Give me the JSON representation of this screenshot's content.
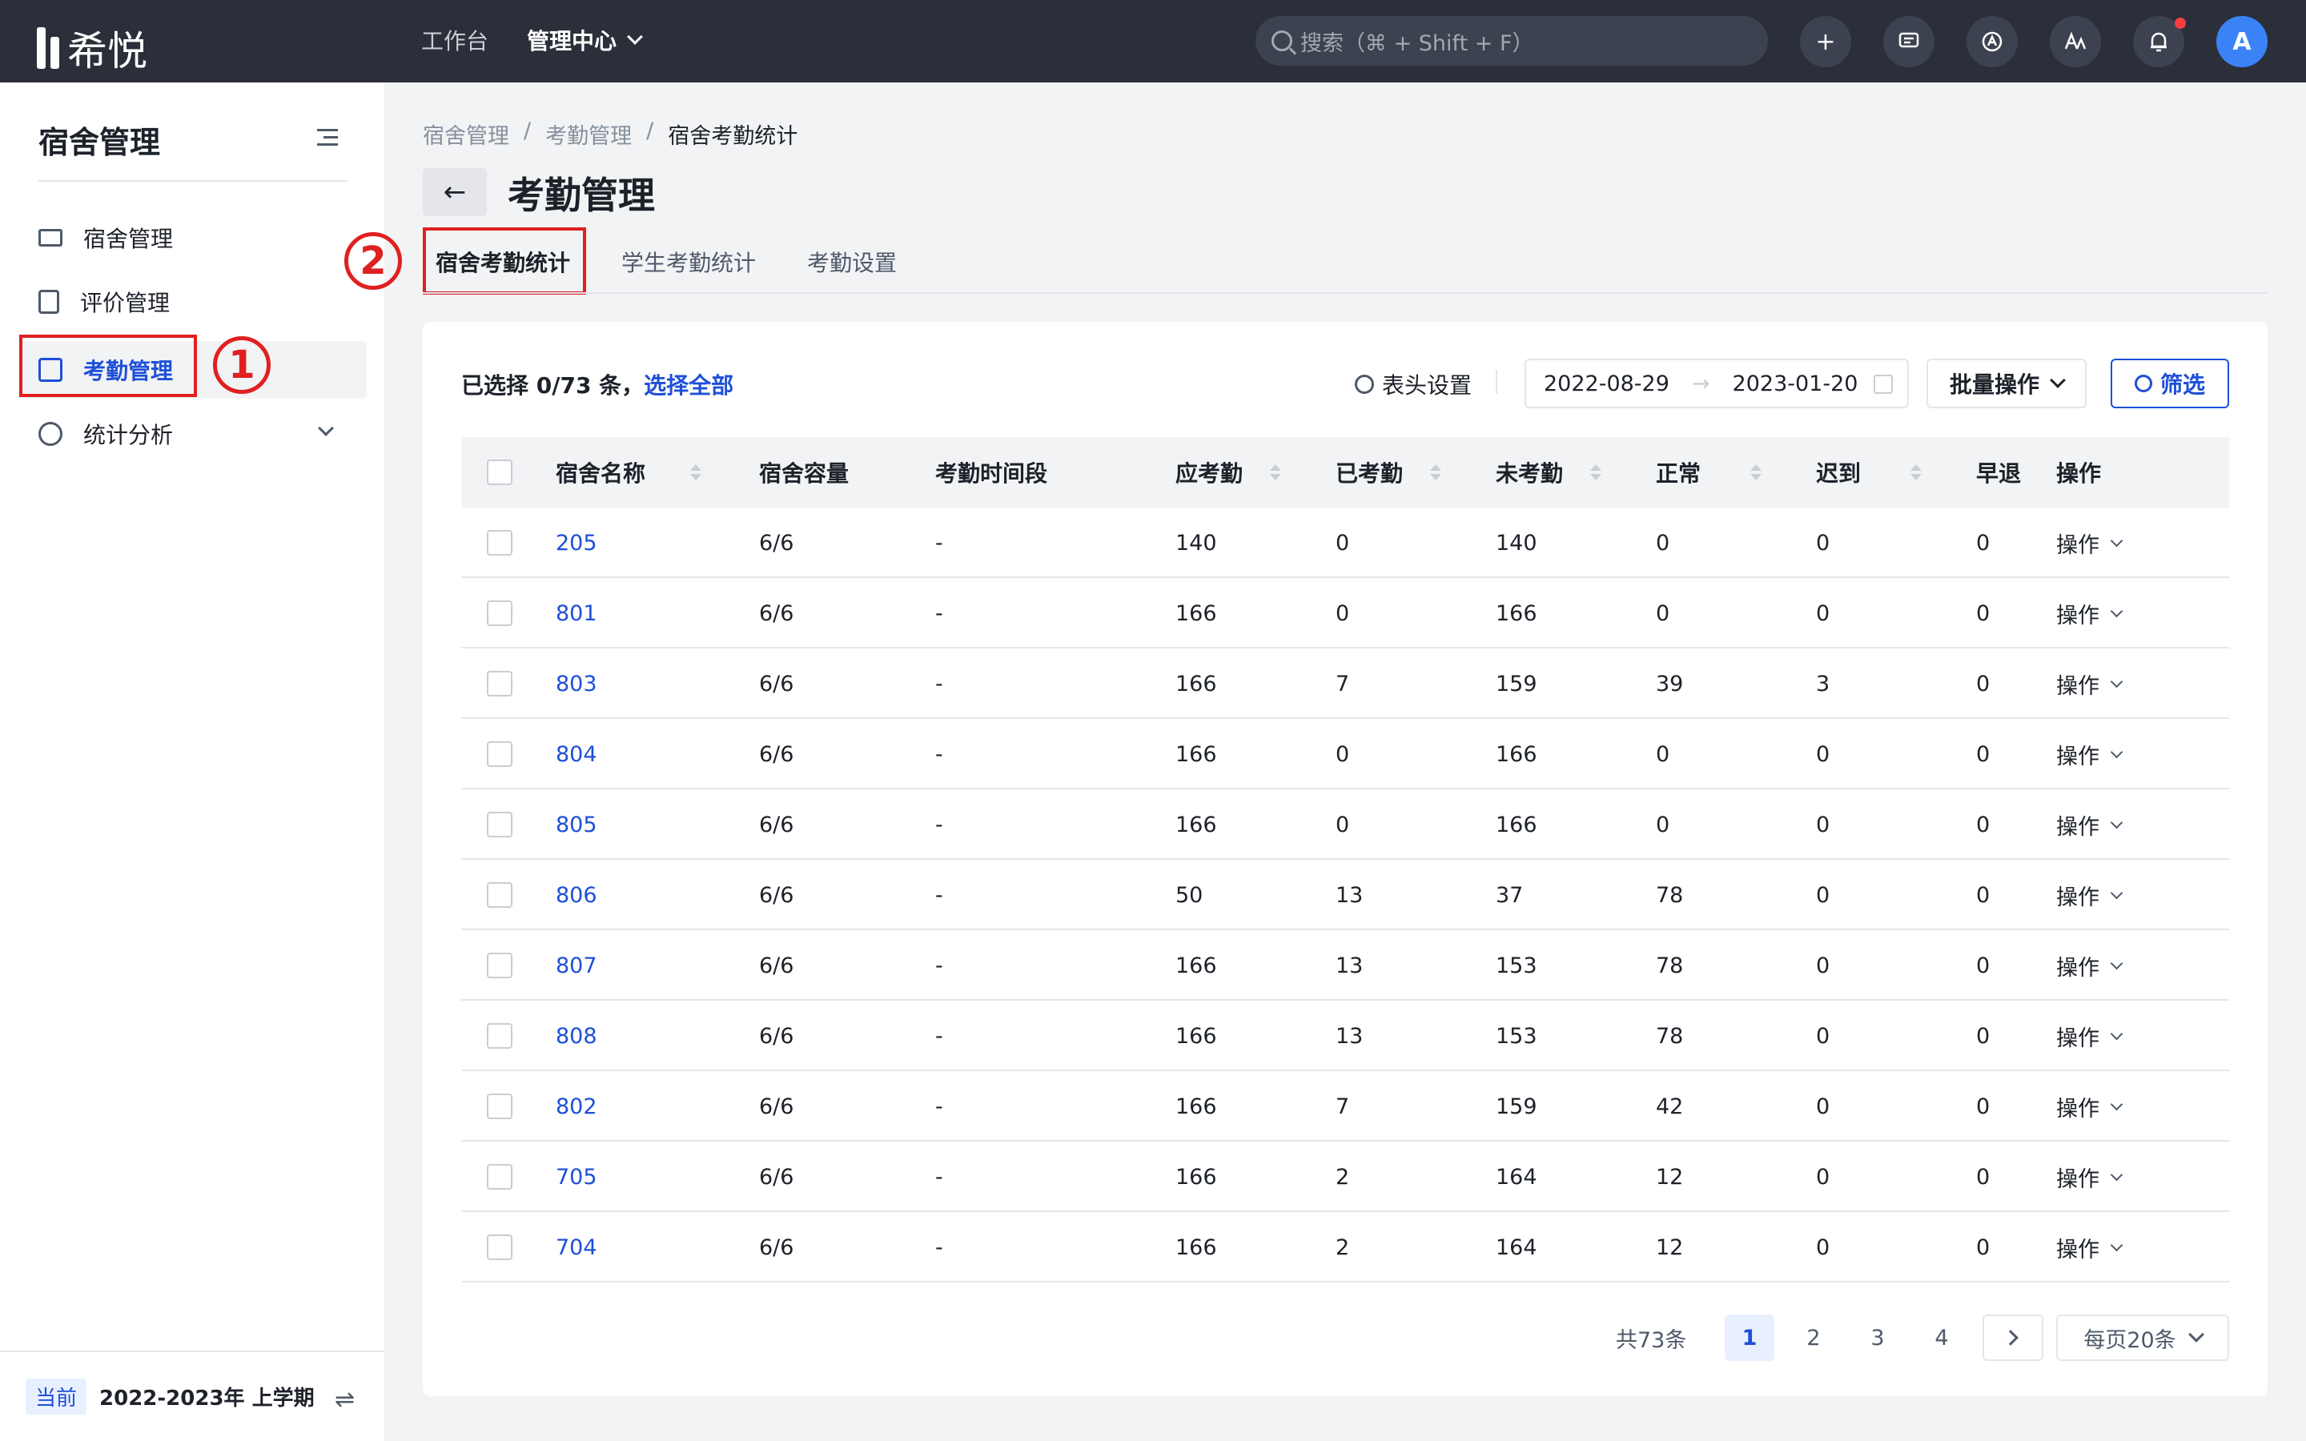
{
  "app": {
    "logo_text": "希悦"
  },
  "topnav": {
    "items": [
      "工作台",
      "管理中心"
    ],
    "search_placeholder": "搜索（⌘ + Shift + F）",
    "avatar": "A",
    "add": "+"
  },
  "sidebar": {
    "title": "宿舍管理",
    "items": [
      {
        "label": "宿舍管理",
        "icon": "bed-icon"
      },
      {
        "label": "评价管理",
        "icon": "document-chart-icon"
      },
      {
        "label": "考勤管理",
        "icon": "calendar-check-icon"
      },
      {
        "label": "统计分析",
        "icon": "pie-chart-icon"
      }
    ],
    "current_tag": "当前",
    "term": "2022-2023年 上学期",
    "switch": "⇌"
  },
  "annotations": {
    "one": "1",
    "two": "2"
  },
  "breadcrumb": [
    "宿舍管理",
    "/",
    "考勤管理",
    "/",
    "宿舍考勤统计"
  ],
  "page": {
    "title": "考勤管理",
    "back": "←"
  },
  "tabs": [
    "宿舍考勤统计",
    "学生考勤统计",
    "考勤设置"
  ],
  "toolbar": {
    "selection": "已选择 0/73 条，",
    "select_all": "选择全部",
    "column_settings": "表头设置",
    "date_start": "2022-08-29",
    "date_arrow": "→",
    "date_end": "2023-01-20",
    "batch": "批量操作",
    "filter": "筛选"
  },
  "table": {
    "headers": [
      "宿舍名称",
      "宿舍容量",
      "考勤时间段",
      "应考勤",
      "已考勤",
      "未考勤",
      "正常",
      "迟到",
      "早退",
      "操作"
    ],
    "rows": [
      [
        "205",
        "6/6",
        "-",
        "140",
        "0",
        "140",
        "0",
        "0",
        "0",
        "操作"
      ],
      [
        "801",
        "6/6",
        "-",
        "166",
        "0",
        "166",
        "0",
        "0",
        "0",
        "操作"
      ],
      [
        "803",
        "6/6",
        "-",
        "166",
        "7",
        "159",
        "39",
        "3",
        "0",
        "操作"
      ],
      [
        "804",
        "6/6",
        "-",
        "166",
        "0",
        "166",
        "0",
        "0",
        "0",
        "操作"
      ],
      [
        "805",
        "6/6",
        "-",
        "166",
        "0",
        "166",
        "0",
        "0",
        "0",
        "操作"
      ],
      [
        "806",
        "6/6",
        "-",
        "50",
        "13",
        "37",
        "78",
        "0",
        "0",
        "操作"
      ],
      [
        "807",
        "6/6",
        "-",
        "166",
        "13",
        "153",
        "78",
        "0",
        "0",
        "操作"
      ],
      [
        "808",
        "6/6",
        "-",
        "166",
        "13",
        "153",
        "78",
        "0",
        "0",
        "操作"
      ],
      [
        "802",
        "6/6",
        "-",
        "166",
        "7",
        "159",
        "42",
        "0",
        "0",
        "操作"
      ],
      [
        "705",
        "6/6",
        "-",
        "166",
        "2",
        "164",
        "12",
        "0",
        "0",
        "操作"
      ],
      [
        "704",
        "6/6",
        "-",
        "166",
        "2",
        "164",
        "12",
        "0",
        "0",
        "操作"
      ]
    ]
  },
  "pagination": {
    "total": "共73条",
    "pages": [
      "1",
      "2",
      "3",
      "4"
    ],
    "current": "1",
    "page_size": "每页20条"
  },
  "colors": {
    "accent": "#1e4fd8",
    "topbar": "#2b2f3a",
    "annotation": "#e02020"
  }
}
